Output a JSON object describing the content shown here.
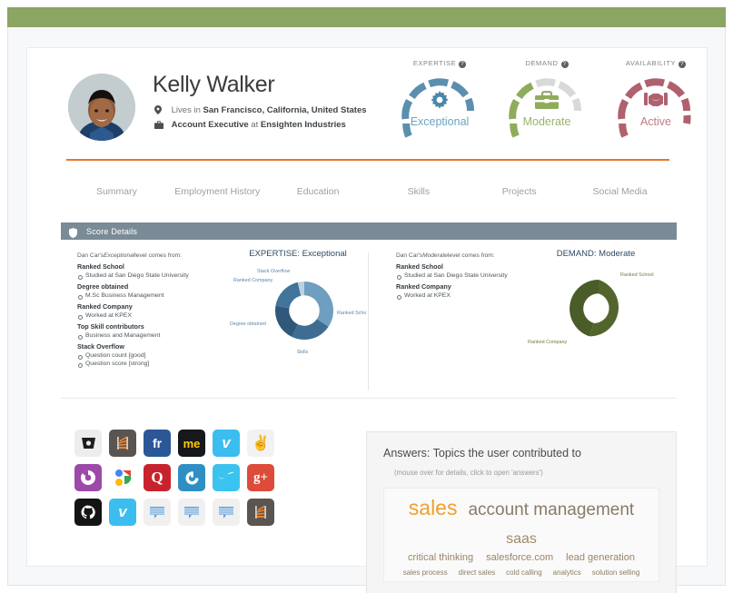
{
  "topbar": {
    "color": "#8ba563"
  },
  "profile": {
    "name": "Kelly Walker",
    "avatar_icon": "user-photo",
    "location_icon": "location-pin-icon",
    "location_prefix": "Lives in",
    "location": "San Francisco, California, United States",
    "work_icon": "briefcase-icon",
    "job_title": "Account Executive",
    "work_connector": "at",
    "company": "Ensighten Industries"
  },
  "gauges": [
    {
      "title": "EXPERTISE",
      "value": "Exceptional",
      "icon": "gear-icon",
      "color": "#5b8fae",
      "track": "#5b8fae",
      "filled_segments": 6,
      "total_segments": 8,
      "help_icon": "question-mark-icon"
    },
    {
      "title": "DEMAND",
      "value": "Moderate",
      "icon": "briefcase-icon",
      "color": "#8fac5b",
      "track": "#d8dada",
      "filled_segments": 3,
      "total_segments": 8,
      "help_icon": "question-mark-icon"
    },
    {
      "title": "AVAILABILITY",
      "value": "Active",
      "icon": "handshake-icon",
      "color": "#b0616e",
      "track": "#b0616e",
      "filled_segments": 7,
      "total_segments": 8,
      "help_icon": "question-mark-icon"
    }
  ],
  "tabs": [
    {
      "label": "Summary"
    },
    {
      "label": "Employment History"
    },
    {
      "label": "Education"
    },
    {
      "label": "Skills"
    },
    {
      "label": "Projects"
    },
    {
      "label": "Social Media"
    }
  ],
  "score_details": {
    "header_label": "Score Details",
    "header_icon": "shield-icon",
    "left": {
      "intro_prefix": "Dan Car's",
      "intro_level": "Exceptional",
      "intro_suffix": "level comes from:",
      "groups": [
        {
          "title": "Ranked School",
          "items": [
            "Studied at San Diego State University"
          ]
        },
        {
          "title": "Degree obtained",
          "items": [
            "M.Sc Business Management"
          ]
        },
        {
          "title": "Ranked Company",
          "items": [
            "Worked at KPEX"
          ]
        },
        {
          "title": "Top Skill contributors",
          "items": [
            "Business and Management"
          ]
        },
        {
          "title": "Stack Overflow",
          "items": [
            "Question count [good]",
            "Question score [strong]"
          ]
        }
      ]
    },
    "right": {
      "intro_prefix": "Dan Car's",
      "intro_level": "Moderate",
      "intro_suffix": "level comes from:",
      "groups": [
        {
          "title": "Ranked School",
          "items": [
            "Studied at  San Diego State University"
          ]
        },
        {
          "title": "Ranked Company",
          "items": [
            "Worked at KPEX"
          ]
        }
      ]
    }
  },
  "chart_data": [
    {
      "type": "pie",
      "title": "EXPERTISE: Exceptional",
      "categories": [
        "Ranked School",
        "Skills",
        "Degree obtained",
        "Ranked Company",
        "Stack Overflow"
      ],
      "values": [
        30,
        22,
        22,
        20,
        6
      ],
      "colors": [
        "#6e9fc0",
        "#3e6d91",
        "#2f587a",
        "#40749a",
        "#bcd2e0"
      ],
      "labels_position": "outside",
      "legend": "none",
      "donut": true
    },
    {
      "type": "pie",
      "title": "DEMAND: Moderate",
      "categories": [
        "Ranked School",
        "Ranked Company"
      ],
      "values": [
        55,
        45
      ],
      "colors": [
        "#53652c",
        "#4a5c27"
      ],
      "labels_position": "outside",
      "legend": "none",
      "donut": true
    }
  ],
  "social_icons": [
    {
      "name": "bitbucket-icon",
      "glyph": "◔",
      "bg": "#ededed",
      "fg": "#2a2a2a"
    },
    {
      "name": "stackoverflow-icon",
      "glyph": "☰",
      "bg": "#5a5550",
      "fg": "#f48024"
    },
    {
      "name": "friendfeed-icon",
      "glyph": "fr",
      "bg": "#2b5797",
      "fg": "#ffffff"
    },
    {
      "name": "aboutme-icon",
      "glyph": "me",
      "bg": "#16181a",
      "fg": "#ffcc00"
    },
    {
      "name": "vimeo-icon",
      "glyph": "v",
      "bg": "#3bbdf0",
      "fg": "#ffffff"
    },
    {
      "name": "peace-hand-icon",
      "glyph": "✌",
      "bg": "#f2f2f2",
      "fg": "#262626"
    },
    {
      "name": "picasa-icon",
      "glyph": "◑",
      "bg": "#9c4aa8",
      "fg": "#ffffff"
    },
    {
      "name": "google-icon",
      "glyph": "G",
      "bg": "#ffffff",
      "fg": "#4285f4"
    },
    {
      "name": "quora-icon",
      "glyph": "Q",
      "bg": "#c8232c",
      "fg": "#ffffff"
    },
    {
      "name": "gowalla-icon",
      "glyph": "↺",
      "bg": "#2f8fc4",
      "fg": "#ffffff"
    },
    {
      "name": "checkmark-icon",
      "glyph": "✓",
      "bg": "#3bc3ef",
      "fg": "#ffffff"
    },
    {
      "name": "googleplus-icon",
      "glyph": "g+",
      "bg": "#dd4b39",
      "fg": "#ffffff"
    },
    {
      "name": "github-icon",
      "glyph": "●",
      "bg": "#141414",
      "fg": "#ffffff"
    },
    {
      "name": "vimeo-icon-2",
      "glyph": "v",
      "bg": "#3bbdf0",
      "fg": "#ffffff"
    },
    {
      "name": "comment-bubble-icon-1",
      "glyph": "☰",
      "bg": "#f0f0f0",
      "fg": "#5b9bd5"
    },
    {
      "name": "comment-bubble-icon-2",
      "glyph": "☰",
      "bg": "#f0f0f0",
      "fg": "#5b9bd5"
    },
    {
      "name": "comment-bubble-icon-3",
      "glyph": "☰",
      "bg": "#f0f0f0",
      "fg": "#5b9bd5"
    },
    {
      "name": "stackoverflow-icon-2",
      "glyph": "☰",
      "bg": "#5a5550",
      "fg": "#f48024"
    }
  ],
  "answers": {
    "title": "Answers: Topics the user contributed to",
    "subtitle": "(mouse over for details, click to open 'answers')",
    "tags": {
      "row1": [
        {
          "text": "sales",
          "size": "t-xl"
        },
        {
          "text": "account management",
          "size": "t-lg"
        },
        {
          "text": "saas",
          "size": "t-md"
        }
      ],
      "row2": [
        {
          "text": "critical thinking",
          "size": "t-sm"
        },
        {
          "text": "salesforce.com",
          "size": "t-sm"
        },
        {
          "text": "lead generation",
          "size": "t-sm"
        }
      ],
      "row3": [
        {
          "text": "sales process",
          "size": "t-xs"
        },
        {
          "text": "direct sales",
          "size": "t-xs"
        },
        {
          "text": "cold calling",
          "size": "t-xs"
        },
        {
          "text": "analytics",
          "size": "t-xs"
        },
        {
          "text": "solution selling",
          "size": "t-xs"
        }
      ]
    }
  }
}
